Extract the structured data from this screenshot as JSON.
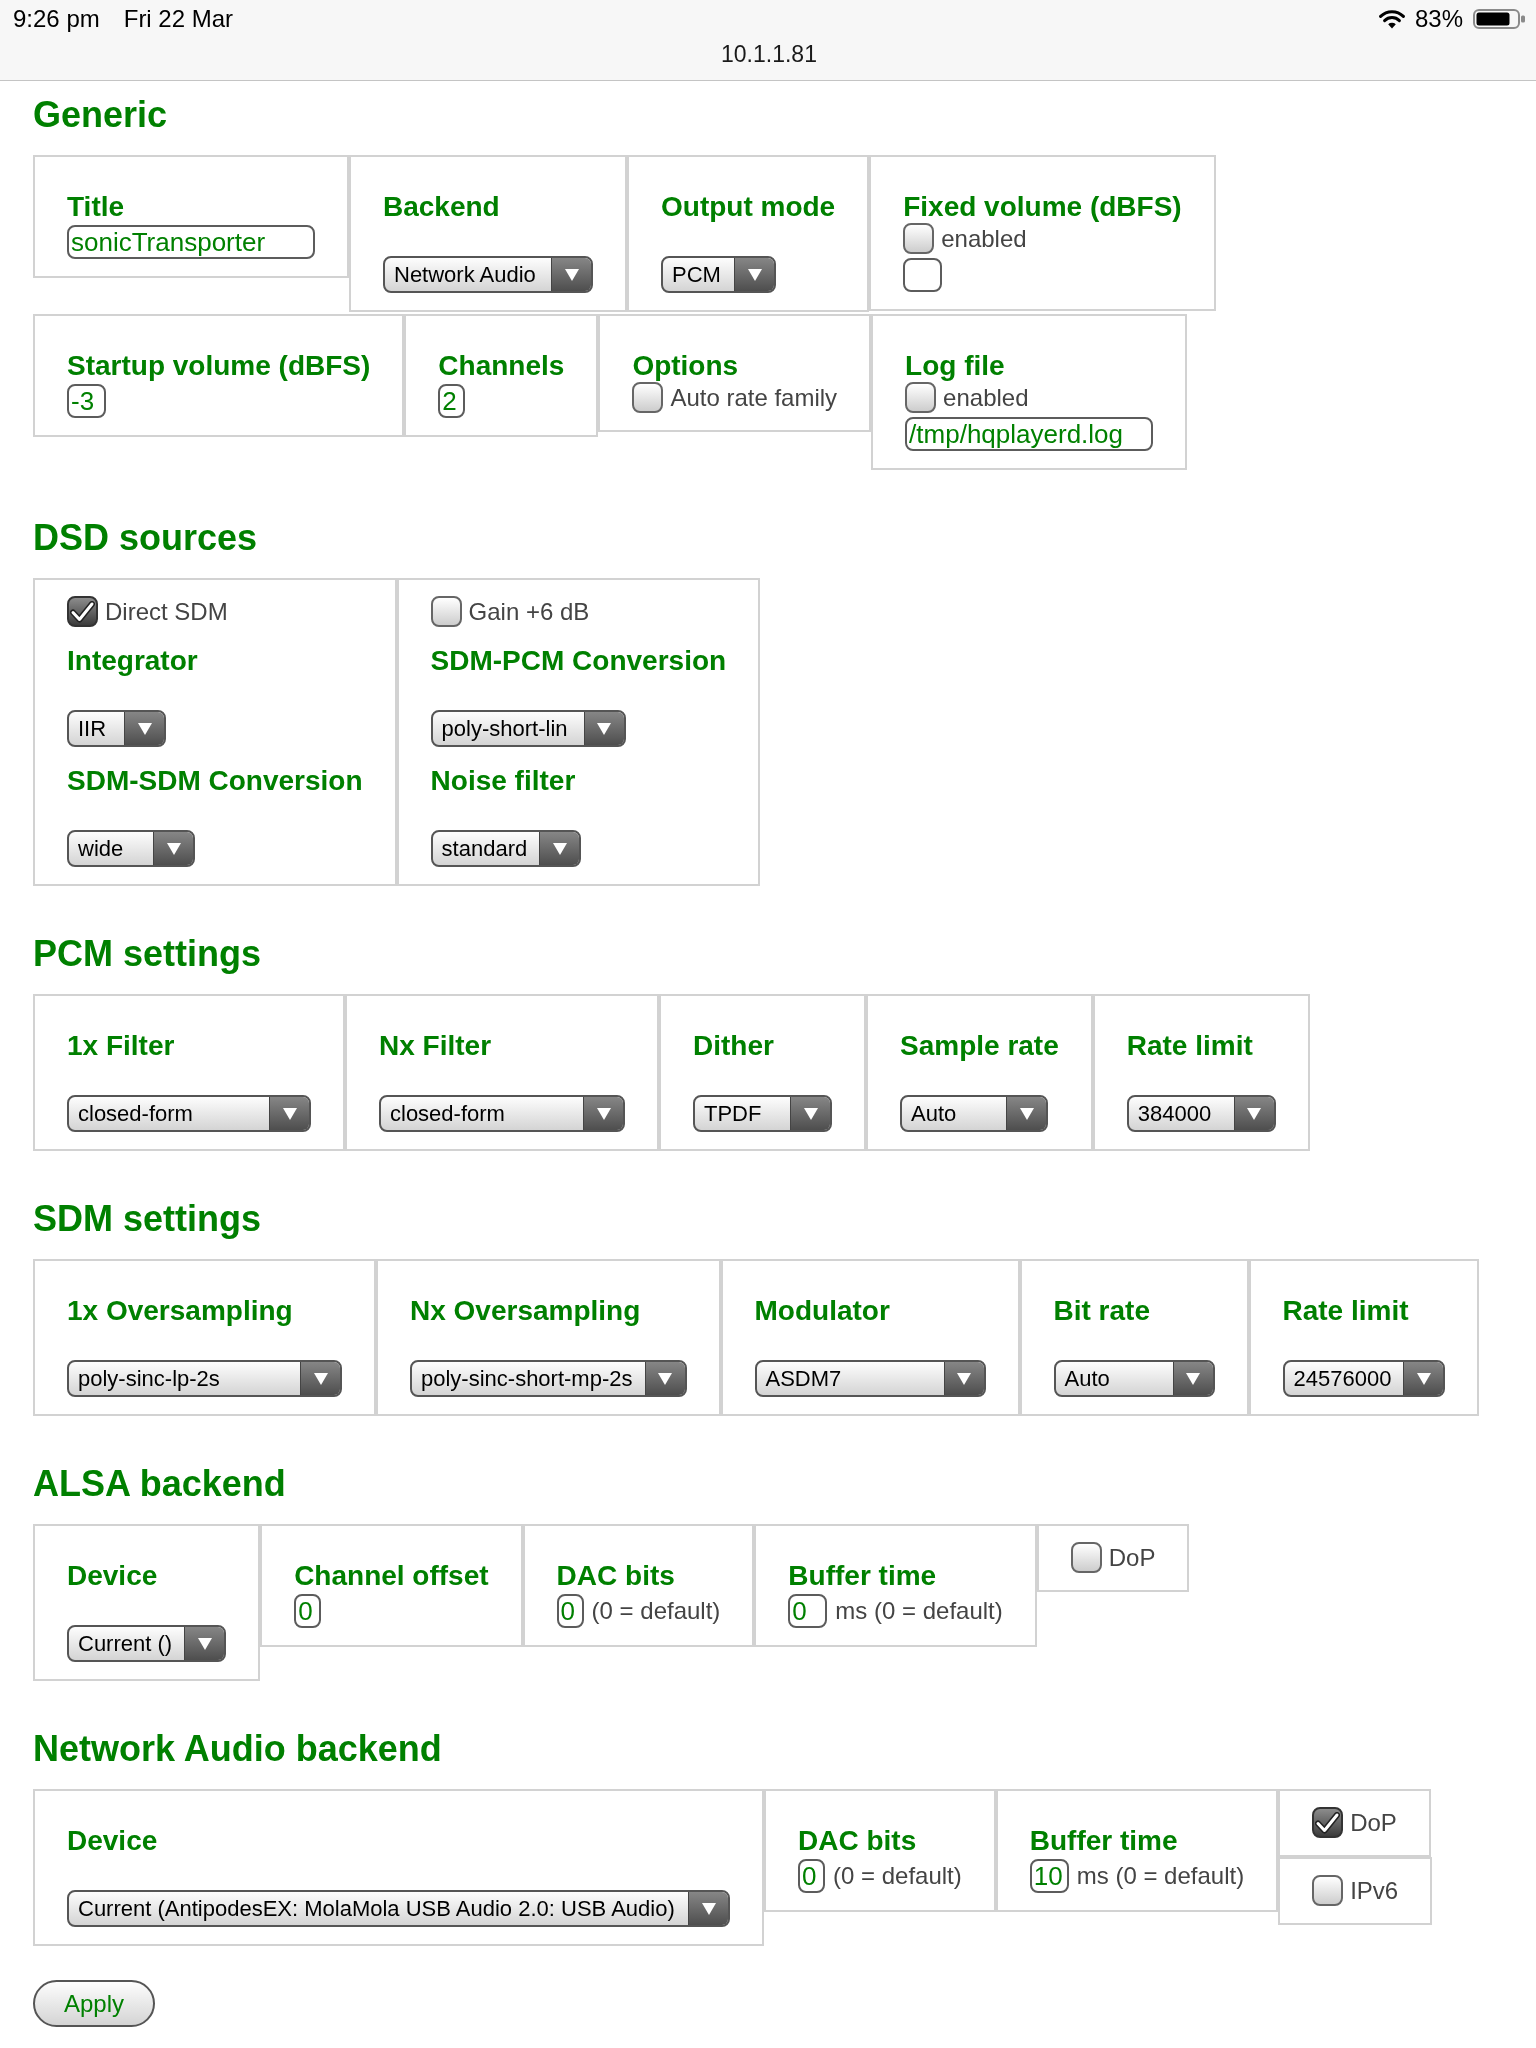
{
  "status_bar": {
    "time": "9:26 pm",
    "date": "Fri 22 Mar",
    "battery": "83%",
    "address": "10.1.1.81"
  },
  "sections": [
    {
      "title": "Generic",
      "cells": [
        {
          "kind": "cell",
          "items": [
            {
              "kind": "label",
              "text": "Title"
            },
            {
              "kind": "text",
              "value": "sonicTransporter"
            }
          ]
        },
        {
          "kind": "cell",
          "items": [
            {
              "kind": "label",
              "text": "Backend"
            },
            {
              "kind": "select",
              "value": "Network Audio"
            }
          ]
        },
        {
          "kind": "cell",
          "items": [
            {
              "kind": "label",
              "text": "Output mode"
            },
            {
              "kind": "select",
              "value": "PCM"
            }
          ]
        },
        {
          "kind": "cell",
          "items": [
            {
              "kind": "label",
              "text": "Fixed volume (dBFS)"
            },
            {
              "kind": "checkbox",
              "label": "enabled",
              "checked": false
            },
            {
              "kind": "number"
            }
          ]
        },
        {
          "kind": "cell",
          "items": [
            {
              "kind": "label",
              "text": "Startup volume (dBFS)"
            },
            {
              "kind": "number",
              "value": "-3"
            }
          ]
        },
        {
          "kind": "cell",
          "items": [
            {
              "kind": "label",
              "text": "Channels"
            },
            {
              "kind": "digit",
              "value": "2"
            }
          ]
        },
        {
          "kind": "cell",
          "items": [
            {
              "kind": "label",
              "text": "Options"
            },
            {
              "kind": "checkbox",
              "label": "Auto rate family",
              "checked": false
            }
          ]
        },
        {
          "kind": "cell",
          "items": [
            {
              "kind": "label",
              "text": "Log file"
            },
            {
              "kind": "checkbox",
              "label": "enabled",
              "checked": false
            },
            {
              "kind": "text",
              "value": "/tmp/hqplayerd.log"
            }
          ]
        }
      ]
    },
    {
      "title": "DSD sources",
      "cells": [
        {
          "kind": "cell",
          "items": [
            {
              "kind": "checkbox",
              "label": "Direct SDM",
              "checked": true
            },
            {
              "kind": "label",
              "text": "Integrator"
            },
            {
              "kind": "select",
              "value": "IIR"
            },
            {
              "kind": "label",
              "text": "SDM-SDM Conversion"
            },
            {
              "kind": "select",
              "value": "wide"
            }
          ]
        },
        {
          "kind": "cell",
          "items": [
            {
              "kind": "checkbox",
              "label": "Gain +6 dB",
              "checked": false
            },
            {
              "kind": "label",
              "text": "SDM-PCM Conversion"
            },
            {
              "kind": "select",
              "value": "poly-short-lin"
            },
            {
              "kind": "label",
              "text": "Noise filter"
            },
            {
              "kind": "select",
              "value": "standard"
            }
          ]
        }
      ]
    },
    {
      "title": "PCM settings",
      "cells": [
        {
          "kind": "cell",
          "items": [
            {
              "kind": "label",
              "text": "1x Filter"
            },
            {
              "kind": "select",
              "value": "closed-form"
            }
          ]
        },
        {
          "kind": "cell",
          "items": [
            {
              "kind": "label",
              "text": "Nx Filter"
            },
            {
              "kind": "select",
              "value": "closed-form"
            }
          ]
        },
        {
          "kind": "cell",
          "items": [
            {
              "kind": "label",
              "text": "Dither"
            },
            {
              "kind": "select",
              "value": "TPDF"
            }
          ]
        },
        {
          "kind": "cell",
          "items": [
            {
              "kind": "label",
              "text": "Sample rate"
            },
            {
              "kind": "select",
              "value": "Auto"
            }
          ]
        },
        {
          "kind": "cell",
          "items": [
            {
              "kind": "label",
              "text": "Rate limit"
            },
            {
              "kind": "select",
              "value": "384000"
            }
          ]
        }
      ]
    },
    {
      "title": "SDM settings",
      "cells": [
        {
          "kind": "cell",
          "items": [
            {
              "kind": "label",
              "text": "1x Oversampling"
            },
            {
              "kind": "select",
              "value": "poly-sinc-lp-2s"
            }
          ]
        },
        {
          "kind": "cell",
          "items": [
            {
              "kind": "label",
              "text": "Nx Oversampling"
            },
            {
              "kind": "select",
              "value": "poly-sinc-short-mp-2s"
            }
          ]
        },
        {
          "kind": "cell",
          "items": [
            {
              "kind": "label",
              "text": "Modulator"
            },
            {
              "kind": "select",
              "value": "ASDM7"
            }
          ]
        },
        {
          "kind": "cell",
          "items": [
            {
              "kind": "label",
              "text": "Bit rate"
            },
            {
              "kind": "select",
              "value": "Auto"
            }
          ]
        },
        {
          "kind": "cell",
          "items": [
            {
              "kind": "label",
              "text": "Rate limit"
            },
            {
              "kind": "select",
              "value": "24576000"
            }
          ]
        }
      ]
    },
    {
      "title": "ALSA backend",
      "cells": [
        {
          "kind": "cell",
          "items": [
            {
              "kind": "label",
              "text": "Device"
            },
            {
              "kind": "select",
              "value": "Current ()"
            }
          ]
        },
        {
          "kind": "cell",
          "items": [
            {
              "kind": "label",
              "text": "Channel offset"
            },
            {
              "kind": "digit",
              "value": "0"
            }
          ]
        },
        {
          "kind": "cell",
          "items": [
            {
              "kind": "label",
              "text": "DAC bits"
            },
            {
              "kind": "digit",
              "value": "0",
              "note": "(0 = default)"
            }
          ]
        },
        {
          "kind": "cell",
          "items": [
            {
              "kind": "label",
              "text": "Buffer time"
            },
            {
              "kind": "number",
              "value": "0",
              "note": "ms (0 = default)"
            }
          ]
        },
        {
          "kind": "cell",
          "items": [
            {
              "kind": "checkbox",
              "label": "DoP",
              "checked": false
            }
          ]
        }
      ]
    },
    {
      "title": "Network Audio backend",
      "cells": [
        {
          "kind": "cell",
          "items": [
            {
              "kind": "label",
              "text": "Device"
            },
            {
              "kind": "select",
              "value": "Current (AntipodesEX: MolaMola USB Audio 2.0: USB Audio)"
            }
          ]
        },
        {
          "kind": "cell",
          "items": [
            {
              "kind": "label",
              "text": "DAC bits"
            },
            {
              "kind": "digit",
              "value": "0",
              "note": "(0 = default)"
            }
          ]
        },
        {
          "kind": "cell",
          "items": [
            {
              "kind": "label",
              "text": "Buffer time"
            },
            {
              "kind": "number",
              "value": "10",
              "note": "ms (0 = default)"
            }
          ]
        },
        {
          "kind": "stack",
          "cells": [
            {
              "kind": "cell",
              "items": [
                {
                  "kind": "checkbox",
                  "label": "DoP",
                  "checked": true
                }
              ]
            },
            {
              "kind": "cell",
              "items": [
                {
                  "kind": "checkbox",
                  "label": "IPv6",
                  "checked": false
                }
              ]
            }
          ]
        }
      ]
    }
  ],
  "apply_button": {
    "label": "Apply"
  }
}
